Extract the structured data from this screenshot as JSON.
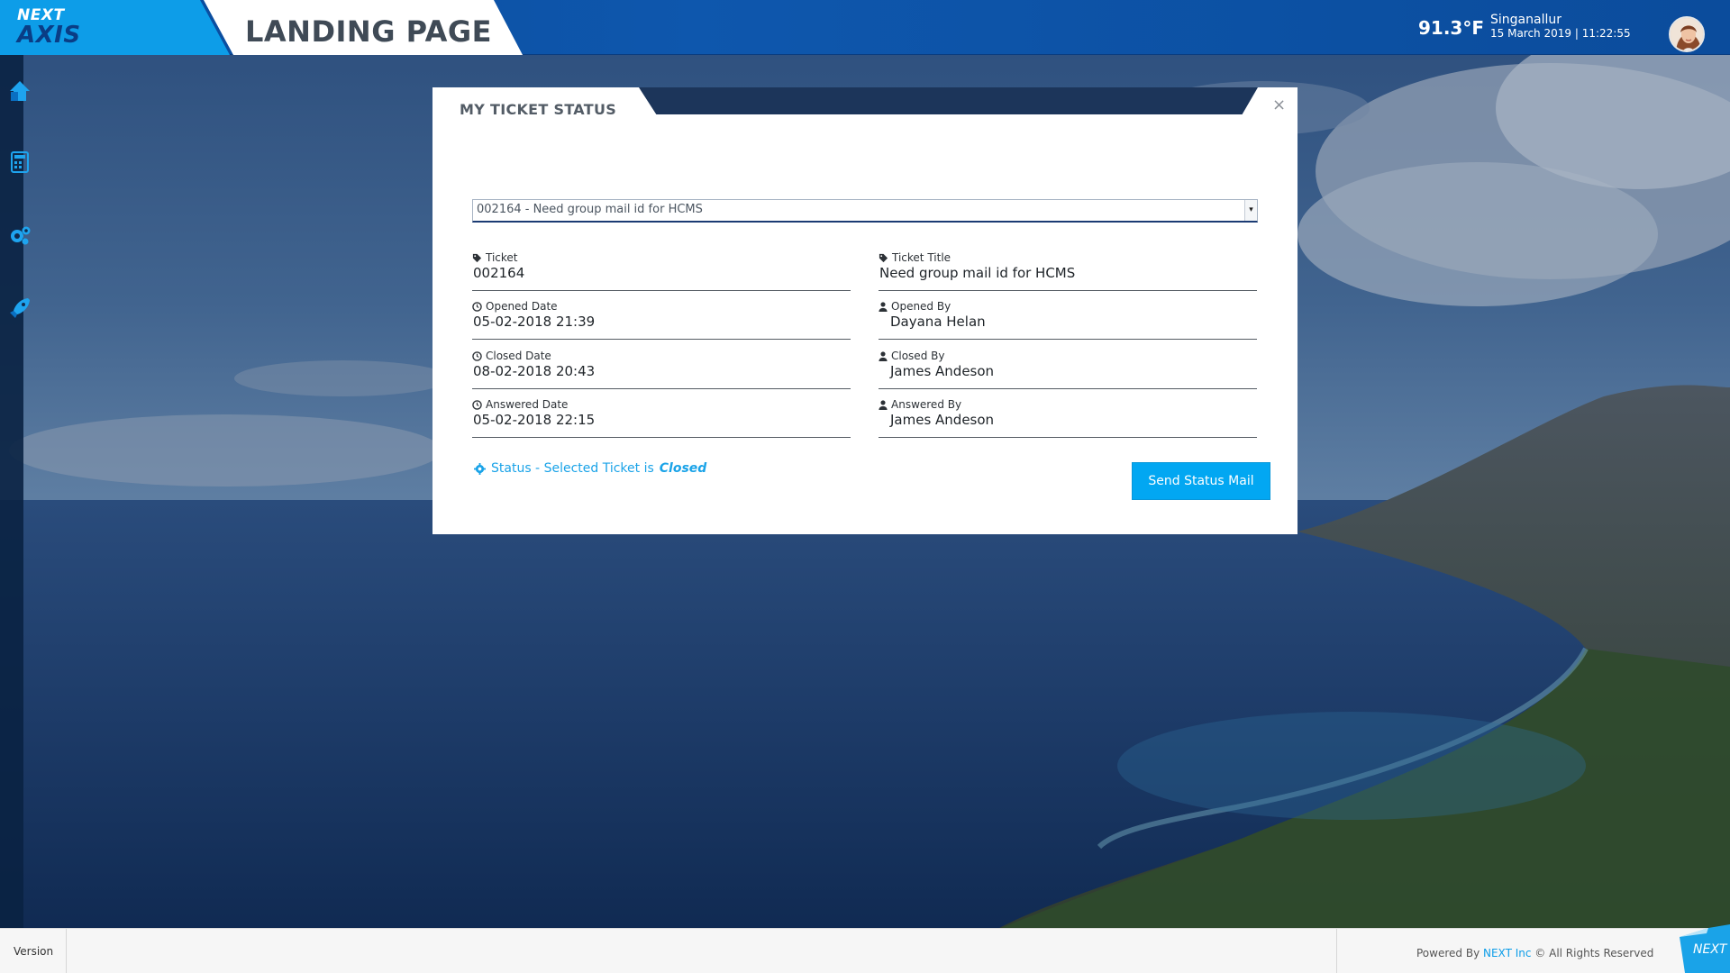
{
  "header": {
    "logo_top": "NEXT",
    "logo_bottom": "AXIS",
    "page_title": "LANDING PAGE",
    "weather": {
      "temperature": "91.3°F",
      "location": "Singanallur",
      "datetime": "15 March 2019 | 11:22:55"
    }
  },
  "sidebar": {
    "items": [
      {
        "icon": "home-icon"
      },
      {
        "icon": "calculator-icon"
      },
      {
        "icon": "gears-icon"
      },
      {
        "icon": "rocket-icon"
      }
    ]
  },
  "modal": {
    "title": "MY TICKET STATUS",
    "close_label": "×",
    "ticket_select": {
      "selected": "002164 - Need group mail id for HCMS",
      "arrow": "▾"
    },
    "fields": {
      "ticket": {
        "label": "Ticket",
        "value": "002164"
      },
      "ticket_title": {
        "label": "Ticket Title",
        "value": "Need group mail id for HCMS"
      },
      "opened_date": {
        "label": "Opened Date",
        "value": "05-02-2018 21:39"
      },
      "opened_by": {
        "label": "Opened By",
        "value": "Dayana Helan"
      },
      "closed_date": {
        "label": "Closed Date",
        "value": "08-02-2018 20:43"
      },
      "closed_by": {
        "label": "Closed By",
        "value": "James Andeson"
      },
      "answered_date": {
        "label": "Answered Date",
        "value": "05-02-2018 22:15"
      },
      "answered_by": {
        "label": "Answered By",
        "value": "James Andeson"
      }
    },
    "status": {
      "prefix": "Status - Selected Ticket is",
      "value": "Closed"
    },
    "send_button": "Send Status Mail"
  },
  "footer": {
    "version_label": "Version",
    "powered_prefix": "Powered By",
    "powered_brand": "NEXT Inc",
    "powered_suffix": "© All Rights Reserved",
    "corner_logo": "NEXT"
  },
  "colors": {
    "header_blue": "#0e57ad",
    "logo_cyan": "#0d9de8",
    "accent": "#02a7f2",
    "modal_head": "#1c355a"
  }
}
